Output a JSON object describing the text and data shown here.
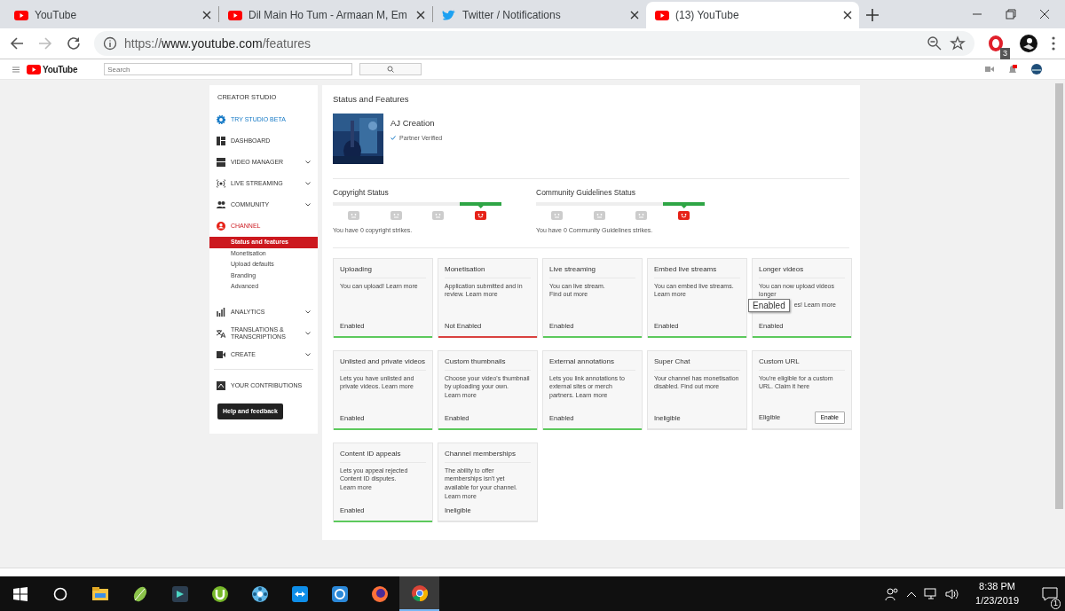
{
  "browser": {
    "tabs": [
      {
        "title": "YouTube",
        "kind": "youtube",
        "selected": false
      },
      {
        "title": "Dil Main Ho Tum - Armaan M, Em",
        "kind": "youtube",
        "selected": false
      },
      {
        "title": "Twitter / Notifications",
        "kind": "twitter",
        "selected": false
      },
      {
        "title": "(13) YouTube",
        "kind": "youtube",
        "selected": true
      }
    ],
    "address": {
      "scheme": "https://",
      "host": "www.youtube.com",
      "path": "/features"
    },
    "extension_badge": "3"
  },
  "header": {
    "logo": "YouTube",
    "search": {
      "placeholder": "Search"
    }
  },
  "sidebar": {
    "title": "CREATOR STUDIO",
    "items": [
      {
        "label": "TRY STUDIO BETA",
        "kind": "gear",
        "has_menu": false,
        "expanded": false,
        "promo": true
      },
      {
        "label": "DASHBOARD",
        "kind": "dashboard",
        "has_menu": false,
        "expanded": false,
        "promo": false
      },
      {
        "label": "VIDEO MANAGER",
        "kind": "video",
        "has_menu": true,
        "expanded": false,
        "promo": false
      },
      {
        "label": "LIVE STREAMING",
        "kind": "live",
        "has_menu": true,
        "expanded": false,
        "promo": false
      },
      {
        "label": "COMMUNITY",
        "kind": "people",
        "has_menu": true,
        "expanded": false,
        "promo": false
      },
      {
        "label": "CHANNEL",
        "kind": "person",
        "has_menu": false,
        "expanded": true,
        "promo": false,
        "children": [
          {
            "label": "Status and features",
            "selected": true
          },
          {
            "label": "Monetisation",
            "selected": false
          },
          {
            "label": "Upload defaults",
            "selected": false
          },
          {
            "label": "Branding",
            "selected": false
          },
          {
            "label": "Advanced",
            "selected": false
          }
        ]
      },
      {
        "label": "ANALYTICS",
        "kind": "chart",
        "has_menu": true,
        "expanded": false,
        "promo": false
      },
      {
        "label": "TRANSLATIONS & TRANSCRIPTIONS",
        "kind": "translate",
        "has_menu": true,
        "expanded": false,
        "promo": false
      },
      {
        "label": "CREATE",
        "kind": "camera",
        "has_menu": true,
        "expanded": false,
        "promo": false
      }
    ],
    "contributions": "YOUR CONTRIBUTIONS",
    "help_button": "Help and feedback"
  },
  "main": {
    "title": "Status and Features",
    "channel": {
      "name": "AJ Creation",
      "verified": "Partner Verified"
    },
    "statuses": [
      {
        "title": "Copyright Status",
        "faces": [
          {
            "selected": false
          },
          {
            "selected": false
          },
          {
            "selected": false
          },
          {
            "selected": true
          }
        ],
        "text": "You have 0 copyright strikes."
      },
      {
        "title": "Community Guidelines Status",
        "faces": [
          {
            "selected": false
          },
          {
            "selected": false
          },
          {
            "selected": false
          },
          {
            "selected": true
          }
        ],
        "text": "You have 0 Community Guidelines strikes."
      }
    ],
    "features": [
      {
        "title": "Uploading",
        "desc": "You can upload!",
        "link": "Learn more",
        "status": "Enabled",
        "color": "#5cc95c"
      },
      {
        "title": "Monetisation",
        "desc": "Application submitted and in review.",
        "link": "Learn more",
        "status": "Not Enabled",
        "color": "#d9423f"
      },
      {
        "title": "Live streaming",
        "desc": "You can live stream.",
        "link": "Find out more",
        "status": "Enabled",
        "color": "#5cc95c"
      },
      {
        "title": "Embed live streams",
        "desc": "You can embed live streams.",
        "link": "Learn more",
        "status": "Enabled",
        "color": "#5cc95c"
      },
      {
        "title": "Longer videos",
        "desc": "You can now upload videos longer",
        "desc_tail": "es!",
        "link": "Learn more",
        "status": "Enabled",
        "color": "#5cc95c",
        "tooltip": "Enabled"
      },
      {
        "title": "Unlisted and private videos",
        "desc": "Lets you have unlisted and private videos.",
        "link": "Learn more",
        "status": "Enabled",
        "color": "#5cc95c"
      },
      {
        "title": "Custom thumbnails",
        "desc": "Choose your video's thumbnail by uploading your own.",
        "link": "Learn more",
        "status": "Enabled",
        "color": "#5cc95c"
      },
      {
        "title": "External annotations",
        "desc": "Lets you link annotations to external sites or merch partners.",
        "link": "Learn more",
        "status": "Enabled",
        "color": "#5cc95c"
      },
      {
        "title": "Super Chat",
        "desc": "Your channel has monetisation disabled.",
        "link": "Find out more",
        "status": "Ineligible"
      },
      {
        "title": "Custom URL",
        "desc": "You're eligible for a custom URL. Claim it",
        "link": "here",
        "status": "Eligible",
        "button": "Enable"
      },
      {
        "title": "Content ID appeals",
        "desc": "Lets you appeal rejected Content ID disputes.",
        "link": "Learn more",
        "status": "Enabled",
        "color": "#5cc95c"
      },
      {
        "title": "Channel memberships",
        "desc": "The ability to offer memberships isn't yet available for your channel.",
        "link": "Learn more",
        "status": "Ineligible"
      }
    ]
  },
  "taskbar": {
    "apps": [
      {
        "kind": "explorer",
        "selected": false
      },
      {
        "kind": "leaf",
        "selected": false
      },
      {
        "kind": "editor",
        "selected": false
      },
      {
        "kind": "torrent",
        "selected": false
      },
      {
        "kind": "reel",
        "selected": false
      },
      {
        "kind": "remote",
        "selected": false
      },
      {
        "kind": "sync",
        "selected": false
      },
      {
        "kind": "firefox",
        "selected": false
      },
      {
        "kind": "chrome",
        "selected": true
      }
    ],
    "time": "8:38 PM",
    "date": "1/23/2019",
    "notifications": "1"
  }
}
